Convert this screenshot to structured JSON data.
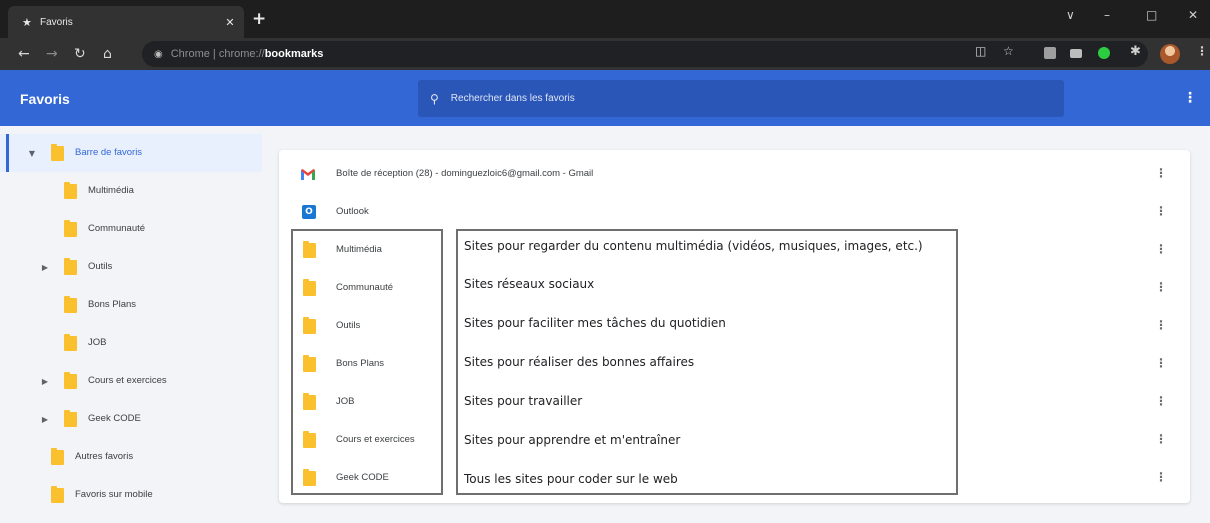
{
  "browser": {
    "tab": {
      "title": "Favoris"
    },
    "new_tab_glyph": "+",
    "window_controls": [
      "∨",
      "–",
      "□",
      "✕"
    ],
    "address": {
      "scheme": "Chrome | chrome://",
      "host": "bookmarks"
    },
    "icons": [
      "back-arrow-icon",
      "forward-arrow-icon",
      "reload-icon",
      "home-icon",
      "site-info-icon",
      "cast-icon",
      "bookmark-star-icon",
      "extension-icon",
      "profile-avatar",
      "chrome-menu-icon"
    ]
  },
  "header": {
    "title": "Favoris",
    "search_placeholder": "Rechercher dans les favoris"
  },
  "sidebar": {
    "items": [
      {
        "label": "Barre de favoris",
        "level": 0,
        "expanded": true,
        "selected": true
      },
      {
        "label": "Multimédia",
        "level": 1
      },
      {
        "label": "Communauté",
        "level": 1
      },
      {
        "label": "Outils",
        "level": 1,
        "collapsed": true
      },
      {
        "label": "Bons Plans",
        "level": 1
      },
      {
        "label": "JOB",
        "level": 1
      },
      {
        "label": "Cours et exercices",
        "level": 1,
        "collapsed": true
      },
      {
        "label": "Geek CODE",
        "level": 1,
        "collapsed": true
      },
      {
        "label": "Autres favoris",
        "level": 0
      },
      {
        "label": "Favoris sur mobile",
        "level": 0
      }
    ]
  },
  "list": {
    "items": [
      {
        "label": "Boîte de réception (28) - dominguezloic6@gmail.com - Gmail",
        "icon": "gmail-icon"
      },
      {
        "label": "Outlook",
        "icon": "outlook-icon"
      },
      {
        "label": "Multimédia",
        "icon": "folder-icon"
      },
      {
        "label": "Communauté",
        "icon": "folder-icon"
      },
      {
        "label": "Outils",
        "icon": "folder-icon"
      },
      {
        "label": "Bons Plans",
        "icon": "folder-icon"
      },
      {
        "label": "JOB",
        "icon": "folder-icon"
      },
      {
        "label": "Cours et exercices",
        "icon": "folder-icon"
      },
      {
        "label": "Geek CODE",
        "icon": "folder-icon"
      }
    ]
  },
  "annotations": [
    "Sites pour regarder du contenu multimédia (vidéos, musiques, images, etc.)",
    "Sites réseaux sociaux",
    "Sites pour faciliter mes tâches du quotidien",
    "Sites pour réaliser des bonnes affaires",
    "Sites pour travailler",
    "Sites pour apprendre et m'entraîner",
    "Tous les sites pour coder sur le web"
  ],
  "colors": {
    "accent": "#3367d6",
    "folder": "#fbc02d",
    "titlebar": "#1e1e1e",
    "toolbar": "#323232"
  }
}
